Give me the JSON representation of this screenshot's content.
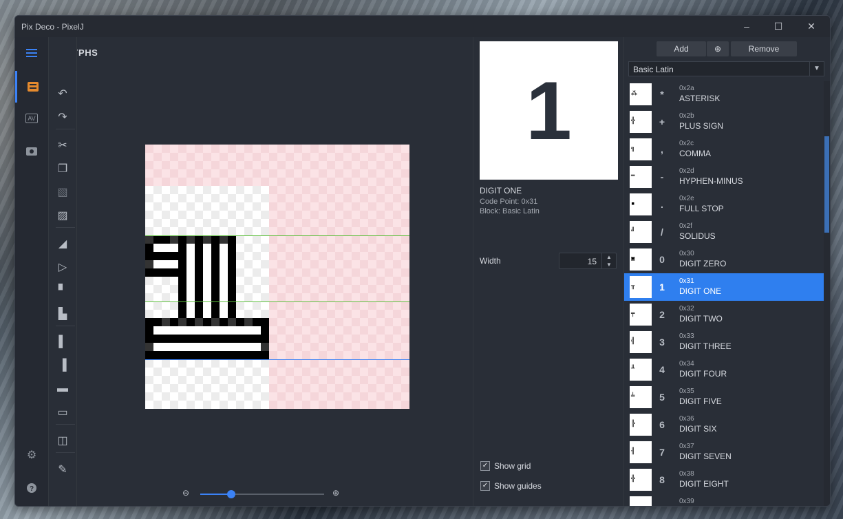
{
  "window": {
    "title": "Pix Deco - PixelJ"
  },
  "panel": {
    "title": "GLYPHS"
  },
  "rail": {
    "menu_icon": "menu-icon",
    "items": [
      "glyphs-icon",
      "kerning-icon",
      "preview-icon"
    ],
    "bottom": [
      "settings-icon",
      "help-icon"
    ],
    "kerning_label": "AV"
  },
  "toolbar": {
    "tools": [
      "undo-icon",
      "redo-icon",
      "cut-icon",
      "copy-icon",
      "paste-icon",
      "paste-special-icon",
      "flip-horizontal-icon",
      "flip-vertical-icon",
      "move-up-icon",
      "move-down-icon",
      "shift-left-icon",
      "shift-right-icon",
      "insert-row-icon",
      "delete-row-icon",
      "mirror-icon",
      "eraser-icon"
    ]
  },
  "preview": {
    "char": "1",
    "name": "DIGIT ONE",
    "code_point": "Code Point: 0x31",
    "block": "Block: Basic Latin"
  },
  "width": {
    "label": "Width",
    "value": "15"
  },
  "options": {
    "show_grid": "Show grid",
    "show_guides": "Show guides",
    "show_grid_checked": true,
    "show_guides_checked": true
  },
  "zoom": {
    "level": 0.25
  },
  "actions": {
    "add": "Add",
    "remove": "Remove"
  },
  "block_select": {
    "value": "Basic Latin"
  },
  "glyphs": [
    {
      "ch": "*",
      "code": "0x2a",
      "name": "ASTERISK",
      "mini": "⁂"
    },
    {
      "ch": "+",
      "code": "0x2b",
      "name": "PLUS SIGN",
      "mini": "╬"
    },
    {
      "ch": ",",
      "code": "0x2c",
      "name": "COMMA",
      "mini": "╗"
    },
    {
      "ch": "-",
      "code": "0x2d",
      "name": "HYPHEN-MINUS",
      "mini": "═"
    },
    {
      "ch": ".",
      "code": "0x2e",
      "name": "FULL STOP",
      "mini": "▪"
    },
    {
      "ch": "/",
      "code": "0x2f",
      "name": "SOLIDUS",
      "mini": "╝"
    },
    {
      "ch": "0",
      "code": "0x30",
      "name": "DIGIT ZERO",
      "mini": "▣"
    },
    {
      "ch": "1",
      "code": "0x31",
      "name": "DIGIT ONE",
      "mini": "╥"
    },
    {
      "ch": "2",
      "code": "0x32",
      "name": "DIGIT TWO",
      "mini": "╤"
    },
    {
      "ch": "3",
      "code": "0x33",
      "name": "DIGIT THREE",
      "mini": "╣"
    },
    {
      "ch": "4",
      "code": "0x34",
      "name": "DIGIT FOUR",
      "mini": "╨"
    },
    {
      "ch": "5",
      "code": "0x35",
      "name": "DIGIT FIVE",
      "mini": "╧"
    },
    {
      "ch": "6",
      "code": "0x36",
      "name": "DIGIT SIX",
      "mini": "╠"
    },
    {
      "ch": "7",
      "code": "0x37",
      "name": "DIGIT SEVEN",
      "mini": "╢"
    },
    {
      "ch": "8",
      "code": "0x38",
      "name": "DIGIT EIGHT",
      "mini": "╬"
    },
    {
      "ch": "",
      "code": "0x39",
      "name": "",
      "mini": ""
    }
  ],
  "selected_index": 7,
  "colors": {
    "accent": "#2f7fef",
    "guide_green": "#5bbf3a",
    "guide_blue": "#3b82f6"
  }
}
